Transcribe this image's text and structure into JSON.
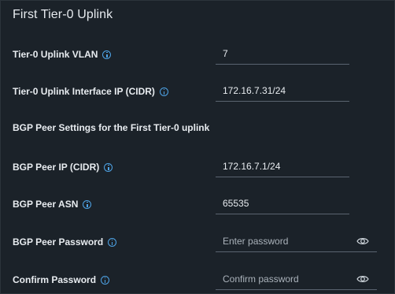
{
  "section": {
    "title": "First Tier-0 Uplink"
  },
  "fields": {
    "uplink_vlan": {
      "label": "Tier-0 Uplink VLAN",
      "value": "7"
    },
    "uplink_ip": {
      "label": "Tier-0 Uplink Interface IP (CIDR)",
      "value": "172.16.7.31/24"
    },
    "bgp_subheader": "BGP Peer Settings for the First Tier-0 uplink",
    "bgp_peer_ip": {
      "label": "BGP Peer IP (CIDR)",
      "value": "172.16.7.1/24"
    },
    "bgp_peer_asn": {
      "label": "BGP Peer ASN",
      "value": "65535"
    },
    "bgp_peer_password": {
      "label": "BGP Peer Password",
      "placeholder": "Enter password",
      "icon": "eye-icon"
    },
    "confirm_password": {
      "label": "Confirm Password",
      "placeholder": "Confirm password",
      "icon": "eye-icon"
    }
  },
  "colors": {
    "background": "#1b2229",
    "info_icon": "#4ea3e6",
    "underline": "#5a6470"
  }
}
